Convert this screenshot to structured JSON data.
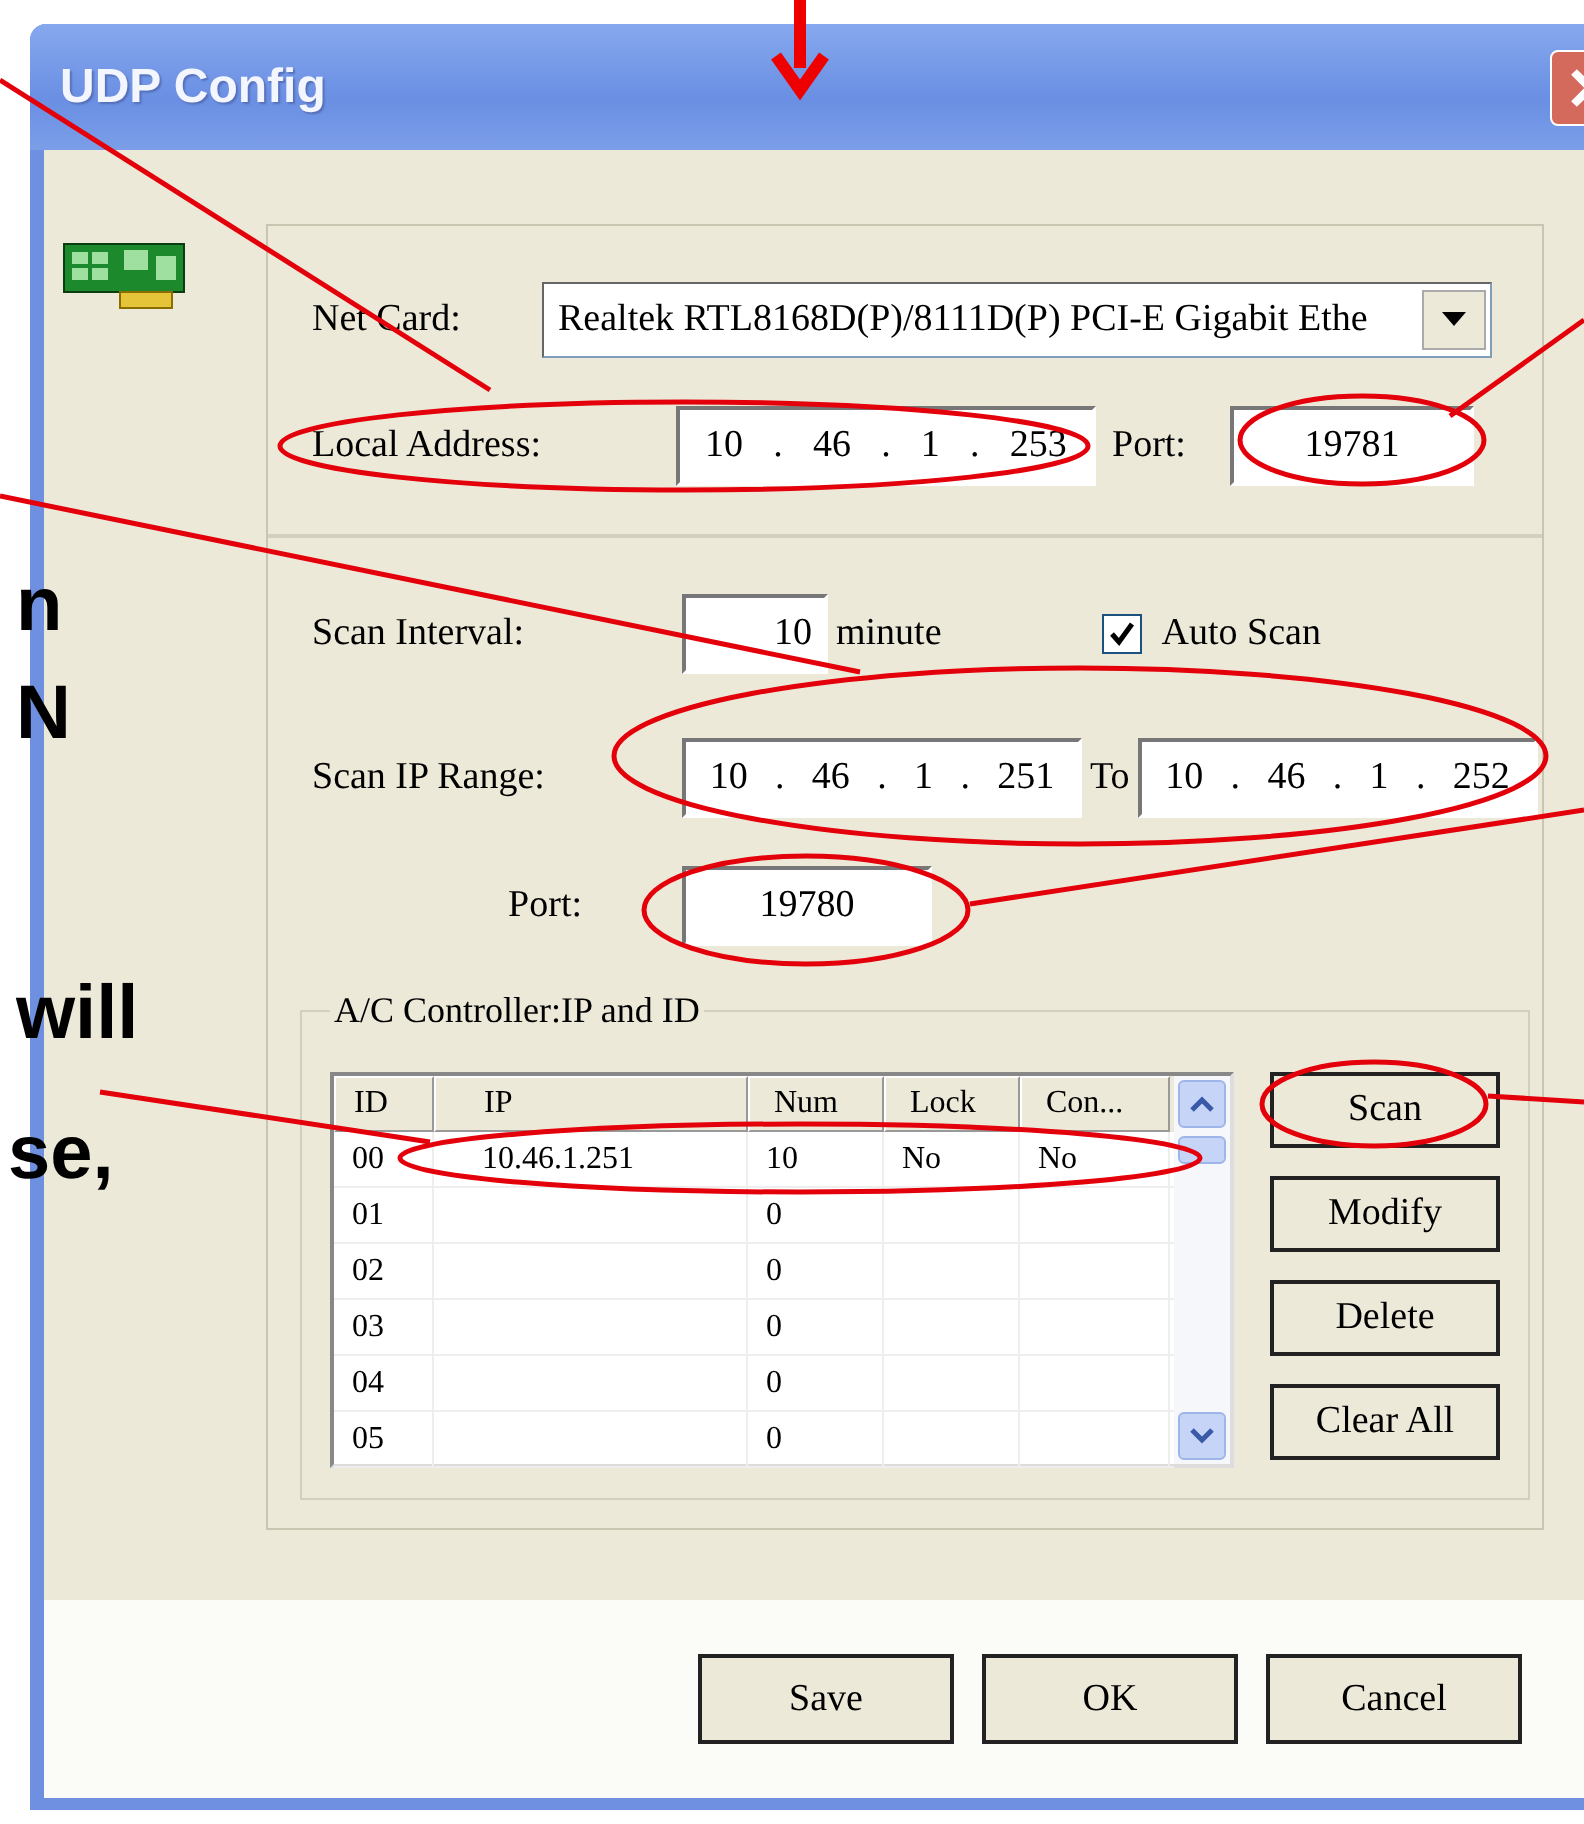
{
  "window": {
    "title": "UDP Config"
  },
  "net_card": {
    "label": "Net Card:",
    "value": "Realtek RTL8168D(P)/8111D(P) PCI-E Gigabit Ethe"
  },
  "ip_separator": ".",
  "local_address": {
    "label": "Local Address:",
    "octets": [
      "10",
      "46",
      "1",
      "253"
    ],
    "port_label": "Port:",
    "port": "19781"
  },
  "scan_interval": {
    "label": "Scan Interval:",
    "value": "10",
    "unit": "minute"
  },
  "auto_scan": {
    "label": "Auto Scan",
    "checked": true
  },
  "scan_range": {
    "label": "Scan IP Range:",
    "from": [
      "10",
      "46",
      "1",
      "251"
    ],
    "to_label": "To",
    "to": [
      "10",
      "46",
      "1",
      "252"
    ]
  },
  "scan_port": {
    "label": "Port:",
    "value": "19780"
  },
  "controller_group": {
    "title": "A/C Controller:IP and ID",
    "columns": [
      "ID",
      "IP",
      "Num",
      "Lock",
      "Con..."
    ],
    "rows": [
      [
        "00",
        "10.46.1.251",
        "10",
        "No",
        "No"
      ],
      [
        "01",
        "",
        "0",
        "",
        ""
      ],
      [
        "02",
        "",
        "0",
        "",
        ""
      ],
      [
        "03",
        "",
        "0",
        "",
        ""
      ],
      [
        "04",
        "",
        "0",
        "",
        ""
      ],
      [
        "05",
        "",
        "0",
        "",
        ""
      ]
    ]
  },
  "side_buttons": [
    "Scan",
    "Modify",
    "Delete",
    "Clear All"
  ],
  "footer_buttons": [
    "Save",
    "OK",
    "Cancel"
  ],
  "annotations": [
    "n",
    "N",
    "will",
    "se,"
  ]
}
